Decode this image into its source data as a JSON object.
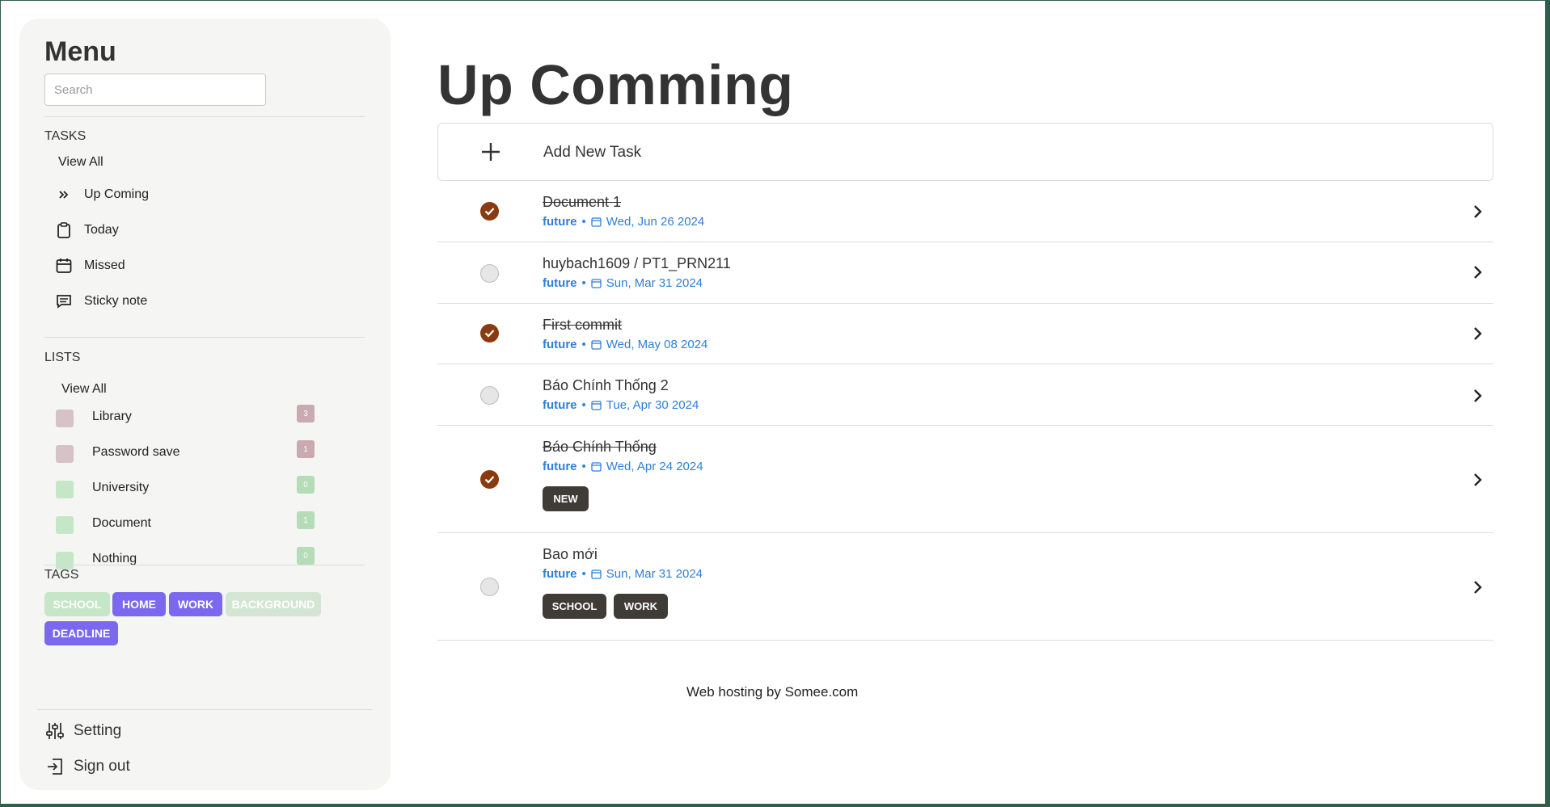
{
  "sidebar": {
    "title": "Menu",
    "search_placeholder": "Search",
    "tasks_title": "TASKS",
    "tasks_view_all": "View All",
    "nav": [
      {
        "label": "Up Coming",
        "icon": "double-chevron-right-icon"
      },
      {
        "label": "Today",
        "icon": "clipboard-icon"
      },
      {
        "label": "Missed",
        "icon": "calendar-icon"
      },
      {
        "label": "Sticky note",
        "icon": "note-icon"
      }
    ],
    "lists_title": "LISTS",
    "lists_view_all": "View All",
    "lists": [
      {
        "label": "Library",
        "count": "3",
        "color": "#d7c3c7",
        "count_color": "#c8aab0"
      },
      {
        "label": "Password save",
        "count": "1",
        "color": "#d7c3c7",
        "count_color": "#c8aab0"
      },
      {
        "label": "University",
        "count": "0",
        "color": "#c6e6c8",
        "count_color": "#b4dcb7"
      },
      {
        "label": "Document",
        "count": "1",
        "color": "#c6e6c8",
        "count_color": "#b4dcb7"
      },
      {
        "label": "Nothing",
        "count": "0",
        "color": "#c6e6c8",
        "count_color": "#b4dcb7"
      }
    ],
    "tags_title": "TAGS",
    "tags": [
      {
        "label": "SCHOOL",
        "color": "#c6e6c8"
      },
      {
        "label": "HOME",
        "color": "#7b68ee"
      },
      {
        "label": "WORK",
        "color": "#7b68ee"
      },
      {
        "label": "BACKGROUND",
        "color": "#d3e6d3"
      },
      {
        "label": "DEADLINE",
        "color": "#7b68ee"
      }
    ],
    "setting_label": "Setting",
    "signout_label": "Sign out"
  },
  "main": {
    "title": "Up Comming",
    "add_task_label": "Add New Task",
    "tasks": [
      {
        "title": "Document 1",
        "list": "future",
        "date": "Wed, Jun 26 2024",
        "done": true,
        "badges": []
      },
      {
        "title": "huybach1609 / PT1_PRN211",
        "list": "future",
        "date": "Sun, Mar 31 2024",
        "done": false,
        "badges": []
      },
      {
        "title": "First commit",
        "list": "future",
        "date": "Wed, May 08 2024",
        "done": true,
        "badges": []
      },
      {
        "title": "Báo Chính Thống 2",
        "list": "future",
        "date": "Tue, Apr 30 2024",
        "done": false,
        "badges": []
      },
      {
        "title": "Báo Chính Thống",
        "list": "future",
        "date": "Wed, Apr 24 2024",
        "done": true,
        "badges": [
          "NEW"
        ]
      },
      {
        "title": "Bao mới",
        "list": "future",
        "date": "Sun, Mar 31 2024",
        "done": false,
        "badges": [
          "SCHOOL",
          "WORK"
        ]
      }
    ],
    "separator": "•"
  },
  "footer": {
    "hosting": "Web hosting by Somee.com"
  },
  "colors": {
    "accent_done": "#8a3a10",
    "meta_blue": "#2e7fd8",
    "tag_purple": "#7b68ee"
  }
}
